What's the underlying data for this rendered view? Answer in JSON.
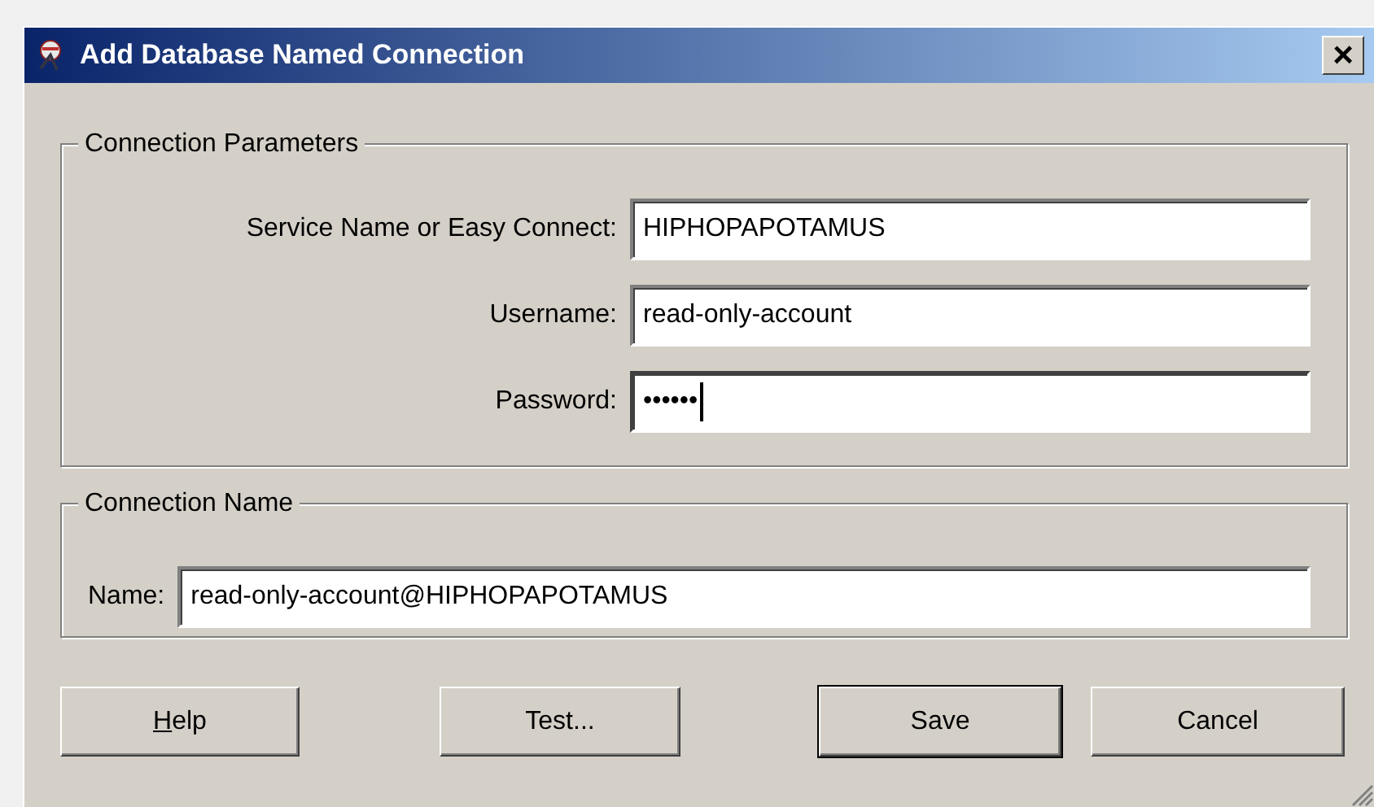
{
  "window": {
    "title": "Add Database Named Connection",
    "close": "×"
  },
  "groups": [
    {
      "title": "Connection Parameters",
      "fields": [
        {
          "label": "Service Name or Easy Connect:",
          "value": "HIPHOPAPOTAMUS",
          "focused": false
        },
        {
          "label": "Username:",
          "value": "read-only-account",
          "focused": false
        },
        {
          "label": "Password:",
          "value": "••••••",
          "focused": true
        }
      ]
    },
    {
      "title": "Connection Name",
      "fields": [
        {
          "label": "Name:",
          "value": "read-only-account@HIPHOPAPOTAMUS",
          "focused": false
        }
      ]
    }
  ],
  "buttons": [
    {
      "label": "Help",
      "underline_first": true,
      "default": false
    },
    {
      "label": "Test...",
      "default": false
    },
    {
      "label": "Save",
      "default": true
    },
    {
      "label": "Cancel",
      "default": false
    }
  ]
}
